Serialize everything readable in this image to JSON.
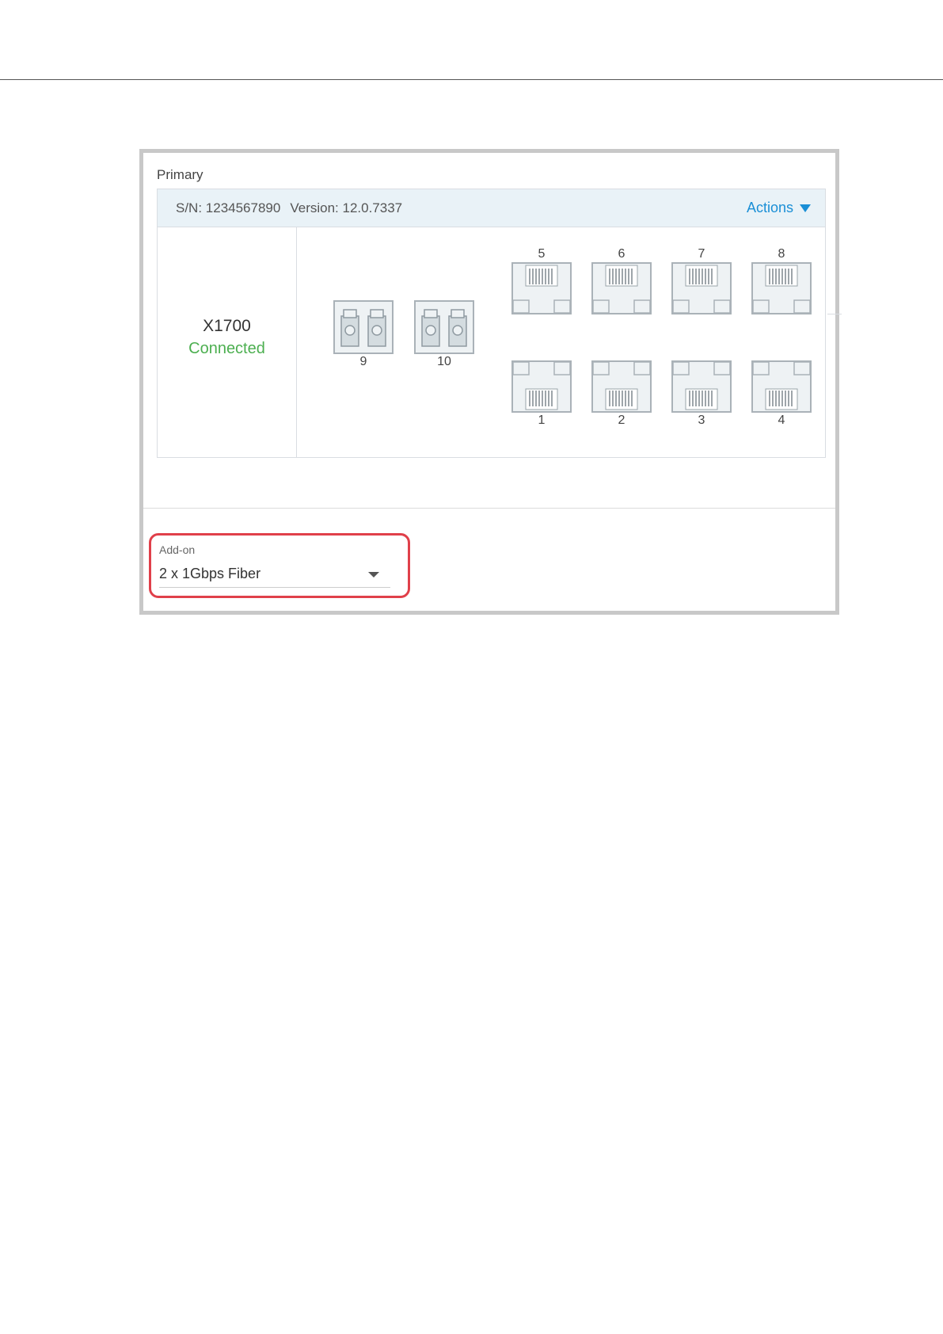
{
  "panel": {
    "section_label": "Primary",
    "serial": "S/N: 1234567890",
    "version": "Version: 12.0.7337",
    "actions_label": "Actions",
    "model": "X1700",
    "status": "Connected",
    "status_color": "#4caf50",
    "accent_color": "#1a8fd6"
  },
  "ports": {
    "fiber": [
      {
        "number": "9"
      },
      {
        "number": "10"
      }
    ],
    "rj45_top": [
      {
        "number": "5"
      },
      {
        "number": "6"
      },
      {
        "number": "7"
      },
      {
        "number": "8"
      }
    ],
    "rj45_bottom": [
      {
        "number": "1"
      },
      {
        "number": "2"
      },
      {
        "number": "3"
      },
      {
        "number": "4"
      }
    ]
  },
  "addon": {
    "label": "Add-on",
    "selected": "2 x 1Gbps Fiber",
    "highlight_color": "#e0404a"
  }
}
